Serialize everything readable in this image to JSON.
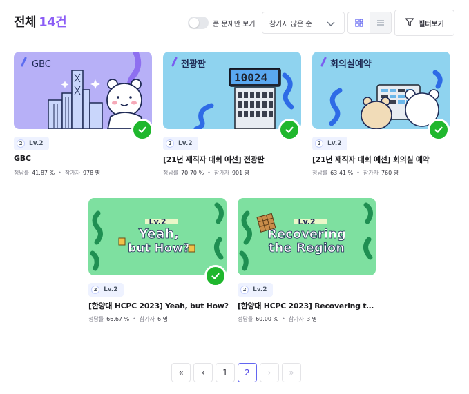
{
  "header": {
    "title": "전체",
    "count": "14건",
    "toggle_label": "푼 문제만 보기",
    "sort_selected": "참가자 많은 순",
    "filter_label": "필터보기"
  },
  "cards": [
    {
      "thumb_text": "GBC",
      "level": "Lv.2",
      "level_num": "2",
      "title": "GBC",
      "rate_label": "정답률",
      "rate": "41.87 %",
      "participants_label": "참가자",
      "participants": "978 명",
      "solved": true,
      "thumb_color": "#b7b0f7"
    },
    {
      "thumb_text": "전광판",
      "level": "Lv.2",
      "level_num": "2",
      "title": "[21년 재직자 대회 예선] 전광판",
      "rate_label": "정답률",
      "rate": "70.70 %",
      "participants_label": "참가자",
      "participants": "901 명",
      "solved": true,
      "thumb_color": "#8fd3ef",
      "display_text": "10024"
    },
    {
      "thumb_text": "회의실예약",
      "level": "Lv.2",
      "level_num": "2",
      "title": "[21년 재직자 대회 예선] 회의실 예약",
      "rate_label": "정답률",
      "rate": "63.41 %",
      "participants_label": "참가자",
      "participants": "760 명",
      "solved": true,
      "thumb_color": "#8fd3ef"
    },
    {
      "thumb_level": "Lv.2",
      "thumb_line1": "Yeah,",
      "thumb_line2": "but How?",
      "level": "Lv.2",
      "level_num": "2",
      "title": "[한양대 HCPC 2023] Yeah, but How?",
      "rate_label": "정답률",
      "rate": "66.67 %",
      "participants_label": "참가자",
      "participants": "6 명",
      "solved": true,
      "thumb_color": "#7ee0a0"
    },
    {
      "thumb_level": "Lv.2",
      "thumb_line1": "Recovering",
      "thumb_line2": "the Region",
      "level": "Lv.2",
      "level_num": "2",
      "title": "[한양대 HCPC 2023] Recovering th...",
      "rate_label": "정답률",
      "rate": "60.00 %",
      "participants_label": "참가자",
      "participants": "3 명",
      "solved": false,
      "thumb_color": "#7ee0a0"
    }
  ],
  "pagination": {
    "first": "«",
    "prev": "‹",
    "pages": [
      "1",
      "2"
    ],
    "current": "2",
    "next": "›",
    "last": "»"
  },
  "colors": {
    "accent": "#8b5cf6",
    "solved_check": "#1fb72d",
    "page_active": "#6366f1"
  }
}
